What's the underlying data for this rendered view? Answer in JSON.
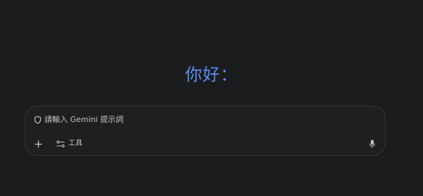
{
  "greeting": "你好：",
  "composer": {
    "placeholder": "請輸入 Gemini 提示詞",
    "tools_label": "工具"
  },
  "icons": {
    "prompt": "shield-icon",
    "add": "plus-icon",
    "tools": "tools-icon",
    "voice": "mic-icon"
  },
  "colors": {
    "background": "#1b1c1d",
    "greeting": "#5a8ff5",
    "composer_border": "#34363a",
    "text_secondary": "#c4c7c5"
  }
}
